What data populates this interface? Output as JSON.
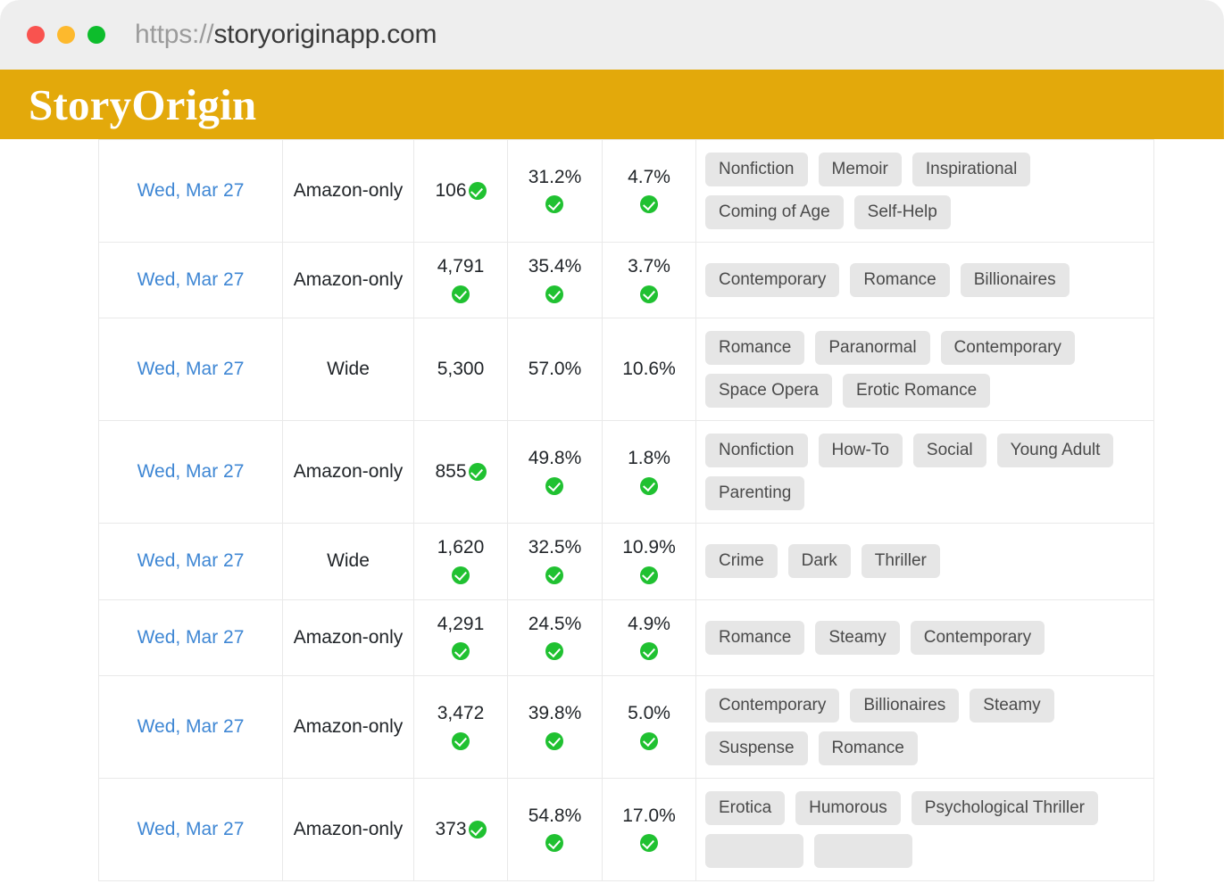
{
  "browser": {
    "url_scheme": "https://",
    "url_host": "storyoriginapp.com",
    "traffic_lights": [
      {
        "name": "close-dot",
        "color": "#f9534f"
      },
      {
        "name": "minimize-dot",
        "color": "#fdb92d"
      },
      {
        "name": "maximize-dot",
        "color": "#0dbd2c"
      }
    ]
  },
  "site": {
    "brand": "StoryOrigin",
    "brand_color": "#e3a90b",
    "link_color": "#3f87d4",
    "check_color": "#20c131",
    "pill_bg": "#e6e6e6"
  },
  "table": {
    "rows": [
      {
        "date": "Wed, Mar 27",
        "distribution": "Amazon-only",
        "count": "106",
        "count_verified": true,
        "count_check_inline": true,
        "open_rate": "31.2%",
        "open_verified": true,
        "click_rate": "4.7%",
        "click_verified": true,
        "genres": [
          "Nonfiction",
          "Memoir",
          "Inspirational",
          "Coming of Age",
          "Self-Help"
        ]
      },
      {
        "date": "Wed, Mar 27",
        "distribution": "Amazon-only",
        "count": "4,791",
        "count_verified": true,
        "count_check_inline": false,
        "open_rate": "35.4%",
        "open_verified": true,
        "click_rate": "3.7%",
        "click_verified": true,
        "genres": [
          "Contemporary",
          "Romance",
          "Billionaires"
        ]
      },
      {
        "date": "Wed, Mar 27",
        "distribution": "Wide",
        "count": "5,300",
        "count_verified": false,
        "count_check_inline": false,
        "open_rate": "57.0%",
        "open_verified": false,
        "click_rate": "10.6%",
        "click_verified": false,
        "genres": [
          "Romance",
          "Paranormal",
          "Contemporary",
          "Space Opera",
          "Erotic Romance"
        ]
      },
      {
        "date": "Wed, Mar 27",
        "distribution": "Amazon-only",
        "count": "855",
        "count_verified": true,
        "count_check_inline": true,
        "open_rate": "49.8%",
        "open_verified": true,
        "click_rate": "1.8%",
        "click_verified": true,
        "genres": [
          "Nonfiction",
          "How-To",
          "Social",
          "Young Adult",
          "Parenting"
        ]
      },
      {
        "date": "Wed, Mar 27",
        "distribution": "Wide",
        "count": "1,620",
        "count_verified": true,
        "count_check_inline": false,
        "open_rate": "32.5%",
        "open_verified": true,
        "click_rate": "10.9%",
        "click_verified": true,
        "genres": [
          "Crime",
          "Dark",
          "Thriller"
        ]
      },
      {
        "date": "Wed, Mar 27",
        "distribution": "Amazon-only",
        "count": "4,291",
        "count_verified": true,
        "count_check_inline": false,
        "open_rate": "24.5%",
        "open_verified": true,
        "click_rate": "4.9%",
        "click_verified": true,
        "genres": [
          "Romance",
          "Steamy",
          "Contemporary"
        ]
      },
      {
        "date": "Wed, Mar 27",
        "distribution": "Amazon-only",
        "count": "3,472",
        "count_verified": true,
        "count_check_inline": false,
        "open_rate": "39.8%",
        "open_verified": true,
        "click_rate": "5.0%",
        "click_verified": true,
        "genres": [
          "Contemporary",
          "Billionaires",
          "Steamy",
          "Suspense",
          "Romance"
        ]
      },
      {
        "date": "Wed, Mar 27",
        "distribution": "Amazon-only",
        "count": "373",
        "count_verified": true,
        "count_check_inline": true,
        "open_rate": "54.8%",
        "open_verified": true,
        "click_rate": "17.0%",
        "click_verified": true,
        "genres": [
          "Erotica",
          "Humorous",
          "Psychological Thriller",
          "",
          ""
        ]
      }
    ]
  }
}
